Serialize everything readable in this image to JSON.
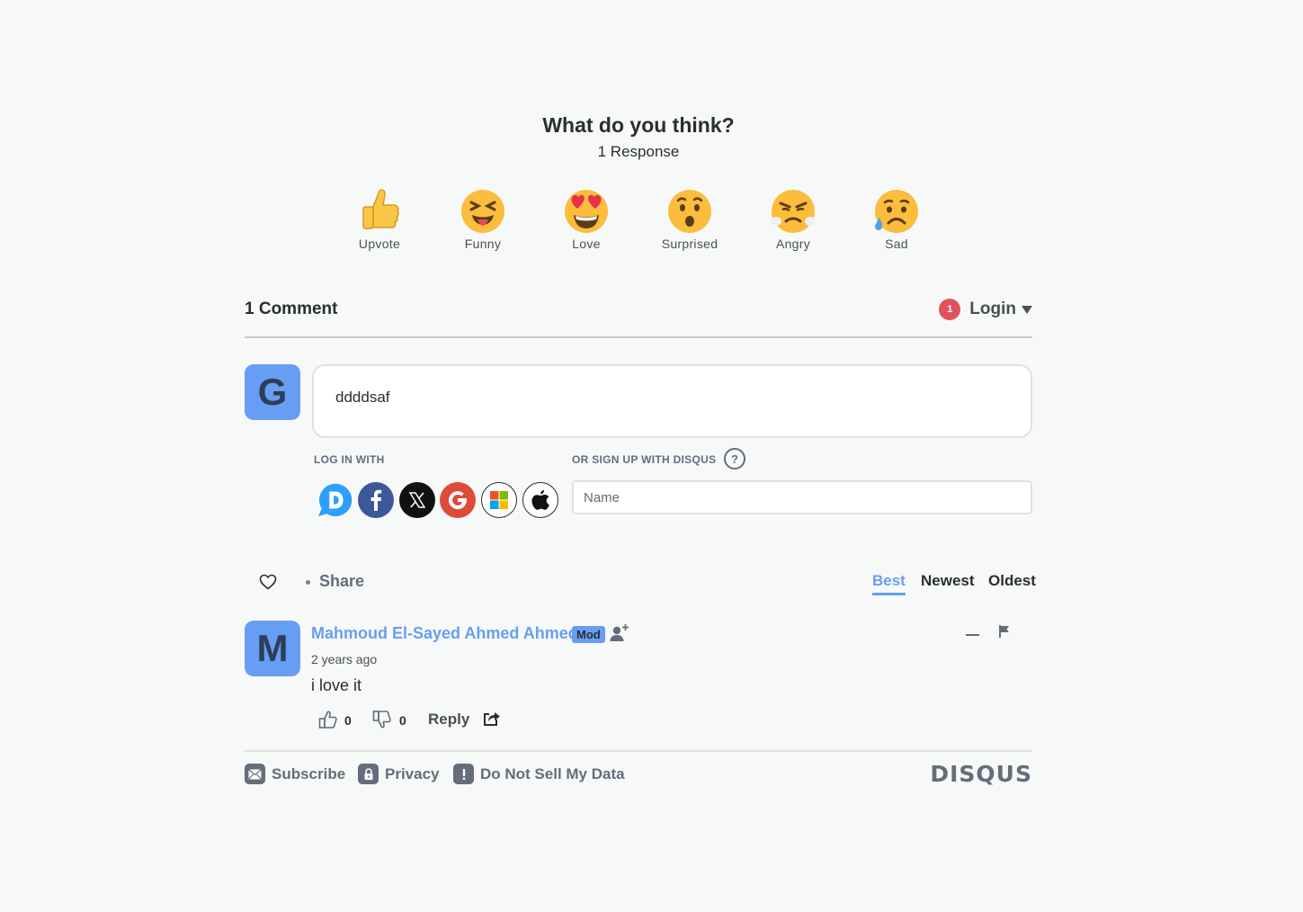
{
  "reactions_header": {
    "title": "What do you think?",
    "response_count": "1 Response"
  },
  "reactions": [
    {
      "label": "Upvote",
      "icon": "thumbs-up-emoji"
    },
    {
      "label": "Funny",
      "icon": "laughing-tongue-emoji"
    },
    {
      "label": "Love",
      "icon": "heart-eyes-emoji"
    },
    {
      "label": "Surprised",
      "icon": "surprised-emoji"
    },
    {
      "label": "Angry",
      "icon": "angry-emoji"
    },
    {
      "label": "Sad",
      "icon": "sad-emoji"
    }
  ],
  "comments_bar": {
    "count_label": "1 Comment",
    "notification_count": "1",
    "login_label": "Login"
  },
  "composer": {
    "avatar_letter": "G",
    "text": "ddddsaf",
    "log_in_with_label": "LOG IN WITH",
    "sign_up_label": "OR SIGN UP WITH DISQUS",
    "help_glyph": "?",
    "name_placeholder": "Name",
    "social_providers": [
      "disqus",
      "facebook",
      "x",
      "google",
      "microsoft",
      "apple"
    ]
  },
  "toolbar": {
    "share_label": "Share",
    "sort_options": [
      "Best",
      "Newest",
      "Oldest"
    ],
    "active_sort": "Best"
  },
  "comment": {
    "avatar_letter": "M",
    "author": "Mahmoud El-Sayed Ahmed Ahmed",
    "badge": "Mod",
    "timestamp": "2 years ago",
    "body": "i love it",
    "upvotes": "0",
    "downvotes": "0",
    "reply_label": "Reply"
  },
  "footer": {
    "subscribe_label": "Subscribe",
    "privacy_label": "Privacy",
    "do_not_sell_label": "Do Not Sell My Data",
    "brand": "DISQUS"
  },
  "colors": {
    "accent": "#679ef3",
    "background": "#f7f9f9",
    "notification": "#e0535b",
    "muted": "#656c7a"
  }
}
